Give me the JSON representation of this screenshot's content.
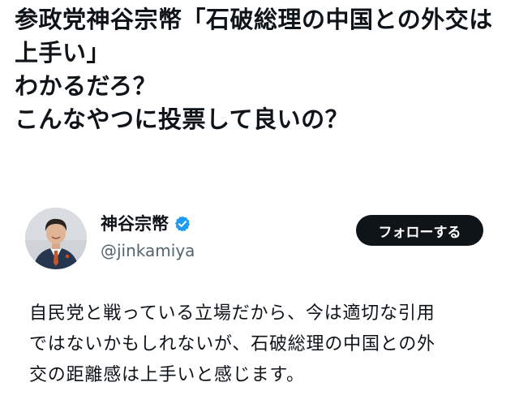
{
  "post": {
    "lines": [
      "参政党神谷宗幣「石破総理の中国との外交は",
      "上手い」",
      "わかるだろ？",
      "こんなやつに投票して良いの？"
    ]
  },
  "embed": {
    "author": {
      "display_name": "神谷宗幣",
      "handle": "@jinkamiya",
      "verified": true,
      "verified_color": "#1d9bf0"
    },
    "follow_label": "フォローする",
    "body_lines": [
      "自民党と戦っている立場だから、今は適切な引用",
      "ではないかもしれないが、石破総理の中国との外",
      "交の距離感は上手いと感じます。"
    ]
  },
  "icons": {
    "verified": "verified-badge-icon",
    "avatar": "profile-photo"
  }
}
